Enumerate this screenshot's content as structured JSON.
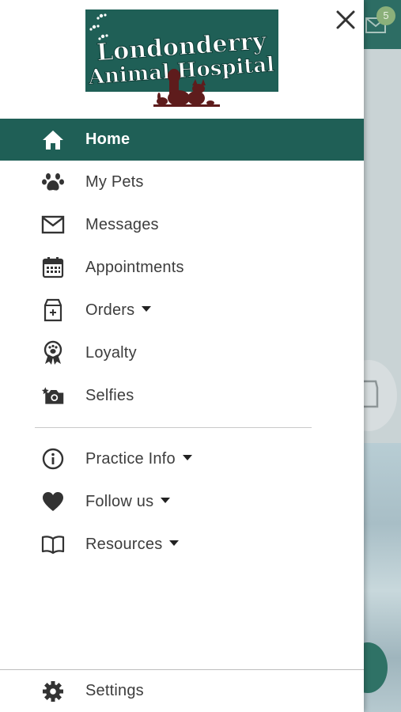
{
  "logo": {
    "line1": "Londonderry",
    "line2": "Animal Hospital",
    "bg_color": "#1f5f56",
    "art_color": "#5e1c1c"
  },
  "background": {
    "badge_count": "5"
  },
  "menu": {
    "items": [
      {
        "label": "Home",
        "icon": "home-icon"
      },
      {
        "label": "My Pets",
        "icon": "paw-icon"
      },
      {
        "label": "Messages",
        "icon": "envelope-icon"
      },
      {
        "label": "Appointments",
        "icon": "calendar-icon"
      },
      {
        "label": "Orders",
        "icon": "food-bag-icon"
      },
      {
        "label": "Loyalty",
        "icon": "award-ribbon-icon"
      },
      {
        "label": "Selfies",
        "icon": "camera-icon"
      }
    ],
    "secondary": [
      {
        "label": "Practice Info",
        "icon": "info-icon"
      },
      {
        "label": "Follow us",
        "icon": "heart-icon"
      },
      {
        "label": "Resources",
        "icon": "book-icon"
      }
    ],
    "settings_label": "Settings"
  },
  "colors": {
    "accent": "#1f5f56",
    "text": "#3d3d3d",
    "icon": "#333333"
  }
}
